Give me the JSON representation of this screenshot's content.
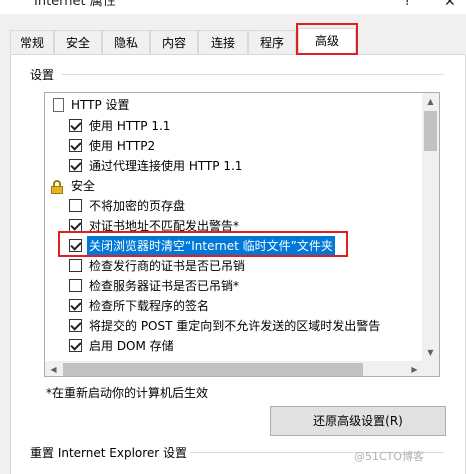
{
  "window": {
    "title": "Internet 属性",
    "help_label": "?",
    "close_label": "✕"
  },
  "tabs": [
    {
      "label": "常规"
    },
    {
      "label": "安全"
    },
    {
      "label": "隐私"
    },
    {
      "label": "内容"
    },
    {
      "label": "连接"
    },
    {
      "label": "程序"
    },
    {
      "label": "高级",
      "active": true
    }
  ],
  "settings": {
    "group_label": "设置",
    "items": [
      {
        "type": "category",
        "icon": "page-icon",
        "label": "HTTP 设置"
      },
      {
        "type": "checkbox",
        "checked": true,
        "label": "使用 HTTP 1.1"
      },
      {
        "type": "checkbox",
        "checked": true,
        "label": "使用 HTTP2"
      },
      {
        "type": "checkbox",
        "checked": true,
        "label": "通过代理连接使用 HTTP 1.1"
      },
      {
        "type": "category",
        "icon": "lock-icon",
        "label": "安全"
      },
      {
        "type": "checkbox",
        "checked": false,
        "label": "不将加密的页存盘"
      },
      {
        "type": "checkbox",
        "checked": true,
        "label": "对证书地址不匹配发出警告*"
      },
      {
        "type": "checkbox",
        "checked": true,
        "selected": true,
        "label": "关闭浏览器时清空“Internet 临时文件”文件夹"
      },
      {
        "type": "checkbox",
        "checked": false,
        "label": "检查发行商的证书是否已吊销"
      },
      {
        "type": "checkbox",
        "checked": false,
        "label": "检查服务器证书是否已吊销*"
      },
      {
        "type": "checkbox",
        "checked": true,
        "label": "检查所下载程序的签名"
      },
      {
        "type": "checkbox",
        "checked": true,
        "label": "将提交的 POST 重定向到不允许发送的区域时发出警告"
      },
      {
        "type": "checkbox",
        "checked": true,
        "label": "启用 DOM 存储"
      }
    ],
    "footnote": "*在重新启动你的计算机后生效",
    "restore_button": "还原高级设置(R)"
  },
  "reset": {
    "group_label": "重置 Internet Explorer 设置"
  },
  "watermark": "@51CTO博客",
  "colors": {
    "selection": "#0078d7",
    "highlight_box": "#e02020"
  }
}
